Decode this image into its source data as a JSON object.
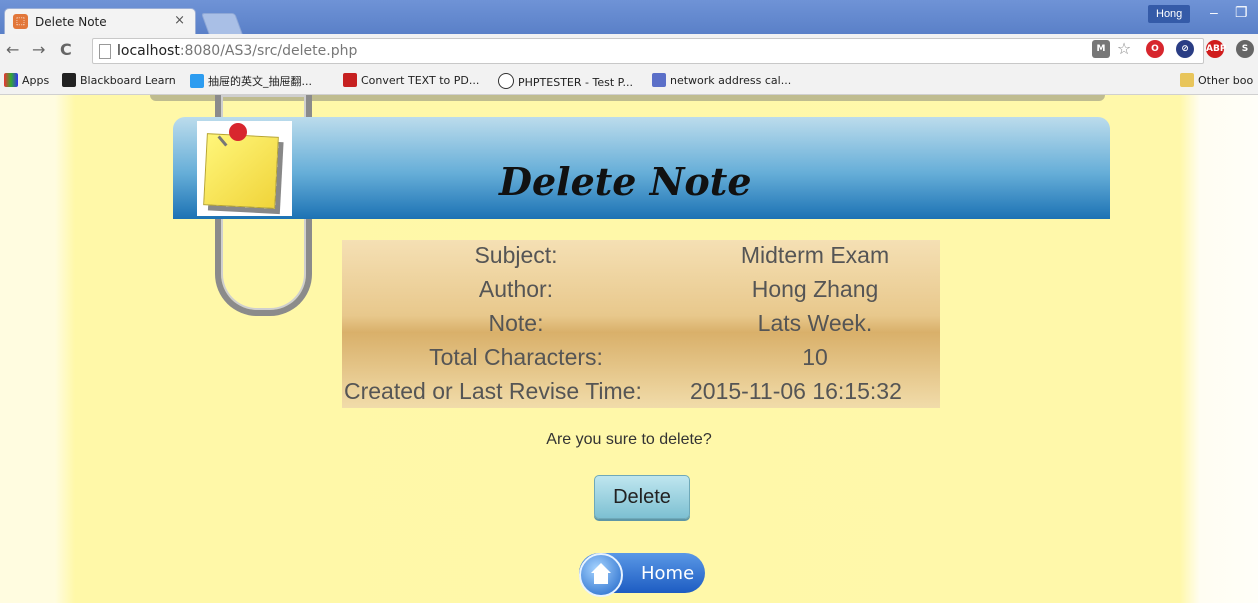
{
  "browser": {
    "tab_title": "Delete Note",
    "tab_close": "×",
    "profile": "Hong",
    "url_host": "localhost",
    "url_rest": ":8080/AS3/src/delete.php",
    "bookmarks": [
      "Apps",
      "Blackboard Learn",
      "抽屉的英文_抽屉翻...",
      "Convert TEXT to PD...",
      "PHPTESTER - Test P...",
      "network address cal...",
      "Other boo"
    ]
  },
  "header": {
    "title": "Delete Note"
  },
  "note": {
    "rows": [
      {
        "label": "Subject:",
        "value": "Midterm Exam"
      },
      {
        "label": "Author:",
        "value": "Hong Zhang"
      },
      {
        "label": "Note:",
        "value": "Lats Week."
      },
      {
        "label": "Total Characters:",
        "value": "10"
      },
      {
        "label": "Created or Last Revise Time:",
        "value": "2015-11-06 16:15:32"
      }
    ]
  },
  "confirm_text": "Are you sure to delete?",
  "buttons": {
    "delete": "Delete",
    "home": "Home"
  }
}
